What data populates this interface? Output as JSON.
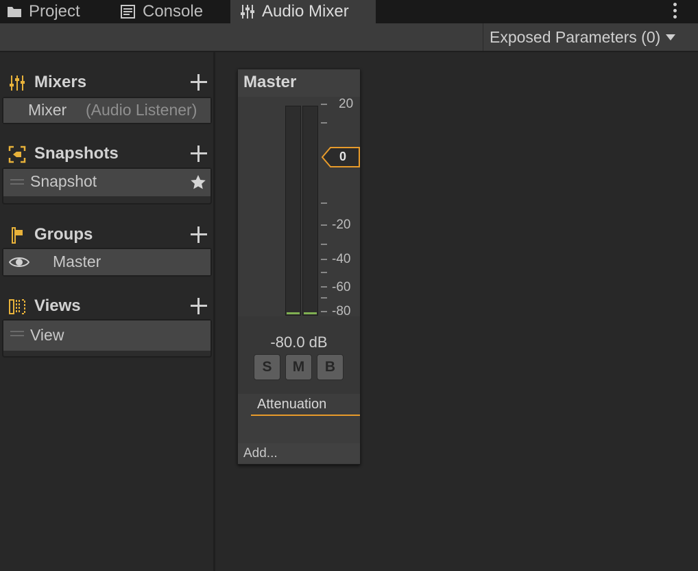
{
  "tabs": [
    {
      "label": "Project",
      "icon": "folder-icon"
    },
    {
      "label": "Console",
      "icon": "console-icon"
    },
    {
      "label": "Audio Mixer",
      "icon": "mixer-sliders-icon",
      "active": true
    }
  ],
  "toolbar": {
    "exposed_parameters": "Exposed Parameters (0)"
  },
  "sidebar": {
    "mixers": {
      "title": "Mixers",
      "items": [
        {
          "name": "Mixer",
          "suffix": "(Audio Listener)"
        }
      ]
    },
    "snapshots": {
      "title": "Snapshots",
      "items": [
        {
          "name": "Snapshot",
          "icon": "star-icon"
        }
      ]
    },
    "groups": {
      "title": "Groups",
      "items": [
        {
          "name": "Master",
          "icon": "eye-icon"
        }
      ]
    },
    "views": {
      "title": "Views",
      "items": [
        {
          "name": "View"
        }
      ]
    }
  },
  "strip": {
    "title": "Master",
    "db_labels": [
      "20",
      "-20",
      "-40",
      "-60",
      "-80"
    ],
    "fader_value": "0",
    "readout": "-80.0 dB",
    "buttons": [
      "S",
      "M",
      "B"
    ],
    "effect": "Attenuation",
    "add_label": "Add..."
  },
  "colors": {
    "accent": "#e89b2b",
    "meter_level": "#7faf52",
    "section_icon": "#e8b23a"
  }
}
